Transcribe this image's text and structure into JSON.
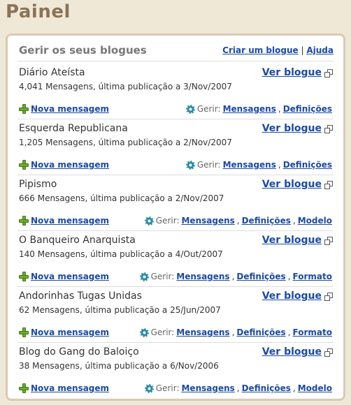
{
  "page": {
    "title": "Painel"
  },
  "panel": {
    "title": "Gerir os seus blogues",
    "create_label": "Criar um blogue",
    "separator": "|",
    "help_label": "Ajuda"
  },
  "labels": {
    "view_blog": "Ver blogue",
    "new_post": "Nova mensagem",
    "manage": "Gerir:",
    "posts": "Mensagens",
    "settings": "Definições"
  },
  "blogs": [
    {
      "name": "Diário Ateísta",
      "meta": "4,041 Mensagens, última publicação a 3/Nov/2007",
      "extra": ""
    },
    {
      "name": "Esquerda Republicana",
      "meta": "1,205 Mensagens, última publicação a 2/Nov/2007",
      "extra": ""
    },
    {
      "name": "Pipismo",
      "meta": "666 Mensagens, última publicação a 2/Nov/2007",
      "extra": "Modelo"
    },
    {
      "name": "O Banqueiro Anarquista",
      "meta": "140 Mensagens, última publicação a 4/Out/2007",
      "extra": "Formato"
    },
    {
      "name": "Andorinhas Tugas Unidas",
      "meta": "62 Mensagens, última publicação a 25/Jun/2007",
      "extra": "Formato"
    },
    {
      "name": "Blog do Gang do Baloiço",
      "meta": "38 Mensagens, última publicação a 6/Nov/2006",
      "extra": "Modelo"
    }
  ]
}
